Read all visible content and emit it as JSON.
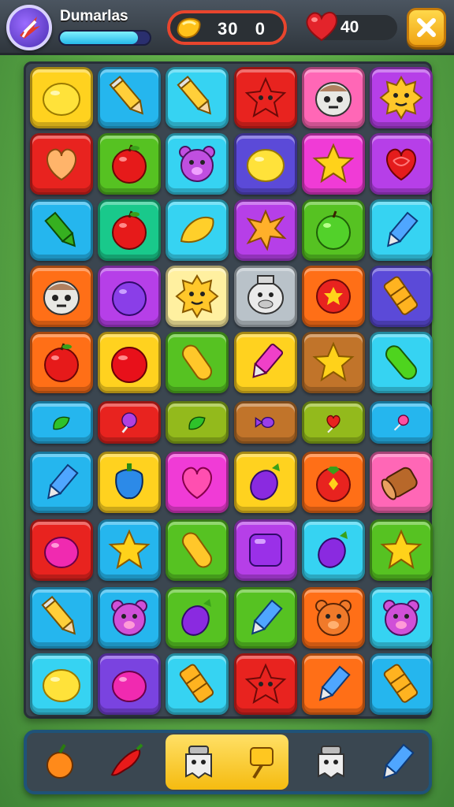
{
  "header": {
    "player_name": "Dumarlas",
    "xp_progress": 0.87,
    "coins": "30   0",
    "lives": "40",
    "avatar_icon": "bird-icon",
    "coin_icon": "gold-coin-icon",
    "heart_icon": "heart-icon",
    "close_icon": "close-icon"
  },
  "colors": {
    "yellow": "#ffd21f",
    "blue": "#25b6ee",
    "cyan": "#36d3f2",
    "red": "#e8231f",
    "pink": "#ff67b6",
    "purple": "#b63fe8",
    "green": "#56c222",
    "teal": "#19c98b",
    "orange": "#ff6f17",
    "violet": "#7a43e0",
    "indigo": "#5b4ad8",
    "cream": "#fff0a0",
    "gray": "#b9c2c9",
    "brown": "#c1742a",
    "magenta": "#f03bd6",
    "olive": "#93ba1c"
  },
  "board": {
    "rows": [
      [
        [
          "yellow",
          "lemon"
        ],
        [
          "blue",
          "pencil"
        ],
        [
          "cyan",
          "pencil"
        ],
        [
          "red",
          "monster-star"
        ],
        [
          "pink",
          "skull-face"
        ],
        [
          "purple",
          "sun-face"
        ]
      ],
      [
        [
          "red",
          "heart-peach"
        ],
        [
          "green",
          "apple"
        ],
        [
          "cyan",
          "bear-face"
        ],
        [
          "indigo",
          "lemon"
        ],
        [
          "magenta",
          "star"
        ],
        [
          "purple",
          "heart-red"
        ]
      ],
      [
        [
          "blue",
          "crayon"
        ],
        [
          "teal",
          "apple"
        ],
        [
          "cyan",
          "mango"
        ],
        [
          "purple",
          "star-splat"
        ],
        [
          "green",
          "apple-green"
        ],
        [
          "cyan",
          "crayon-blue"
        ]
      ],
      [
        [
          "orange",
          "skull-face"
        ],
        [
          "purple",
          "plum"
        ],
        [
          "cream",
          "sun-face"
        ],
        [
          "gray",
          "cow-face"
        ],
        [
          "orange",
          "burst"
        ],
        [
          "indigo",
          "cracker"
        ]
      ],
      [
        [
          "orange",
          "apple"
        ],
        [
          "yellow",
          "cherry-red"
        ],
        [
          "green",
          "bean"
        ],
        [
          "yellow",
          "pen"
        ],
        [
          "brown",
          "star"
        ],
        [
          "cyan",
          "cucumber"
        ]
      ],
      [
        [
          "blue",
          "leaf"
        ],
        [
          "red",
          "lollipop"
        ],
        [
          "olive",
          "leaf"
        ],
        [
          "brown",
          "candy"
        ],
        [
          "olive",
          "heart-pin"
        ],
        [
          "blue",
          "pin"
        ]
      ],
      [
        [
          "blue",
          "crayon-blue"
        ],
        [
          "yellow",
          "bell-pepper"
        ],
        [
          "magenta",
          "heart-pink"
        ],
        [
          "yellow",
          "eggplant"
        ],
        [
          "orange",
          "tomato"
        ],
        [
          "pink",
          "log"
        ]
      ],
      [
        [
          "red",
          "plum-pink"
        ],
        [
          "blue",
          "star"
        ],
        [
          "green",
          "bean"
        ],
        [
          "purple",
          "square"
        ],
        [
          "cyan",
          "eggplant"
        ],
        [
          "green",
          "star"
        ]
      ],
      [
        [
          "blue",
          "pencil"
        ],
        [
          "blue",
          "bear-pink"
        ],
        [
          "green",
          "eggplant"
        ],
        [
          "green",
          "crayon-blue"
        ],
        [
          "orange",
          "bear-orange"
        ],
        [
          "cyan",
          "bear-pink"
        ]
      ],
      [
        [
          "cyan",
          "lemon"
        ],
        [
          "violet",
          "plum-pink"
        ],
        [
          "cyan",
          "cracker"
        ],
        [
          "red",
          "monster-star"
        ],
        [
          "orange",
          "crayon-blue"
        ],
        [
          "blue",
          "cracker"
        ]
      ]
    ]
  },
  "tray": {
    "items": [
      [
        "orange-fruit-icon",
        "orange"
      ],
      [
        "chili-icon",
        "chili"
      ],
      [
        "ghost-jar-icon",
        "ghost"
      ],
      [
        "cheese-pin-icon",
        "pin-yellow"
      ],
      [
        "ghost-jar-icon",
        "ghost"
      ],
      [
        "crayon-icon",
        "crayon-blue"
      ]
    ],
    "selected_index": 2
  }
}
